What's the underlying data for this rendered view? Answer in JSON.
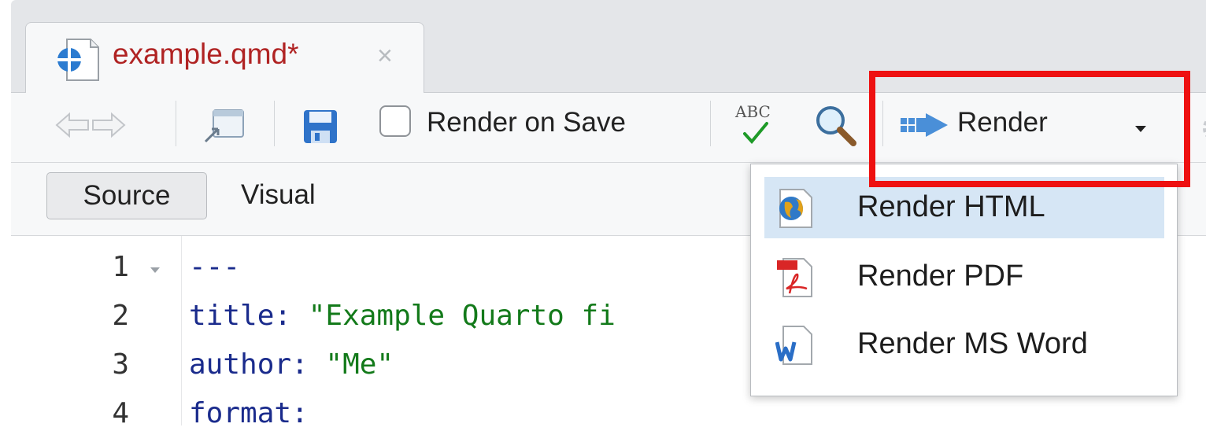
{
  "tab": {
    "title": "example.qmd*",
    "close_icon": "×"
  },
  "toolbar": {
    "render_on_save": "Render on Save",
    "render": "Render",
    "spellcheck_label": "ABC"
  },
  "mode": {
    "source": "Source",
    "visual": "Visual"
  },
  "editor": {
    "line_numbers": [
      "1",
      "2",
      "3",
      "4"
    ],
    "lines": [
      {
        "a": "---",
        "b": ""
      },
      {
        "a": "title: ",
        "b": "\"Example Quarto fi"
      },
      {
        "a": "author: ",
        "b": "\"Me\""
      },
      {
        "a": "format:",
        "b": ""
      }
    ]
  },
  "menu": {
    "items": [
      {
        "label": "Render HTML",
        "icon": "globe-icon"
      },
      {
        "label": "Render PDF",
        "icon": "pdf-icon"
      },
      {
        "label": "Render MS Word",
        "icon": "word-icon"
      }
    ]
  },
  "colors": {
    "highlight": "#ee1111",
    "tab_title": "#b02323",
    "menu_hover": "#d6e6f5"
  }
}
